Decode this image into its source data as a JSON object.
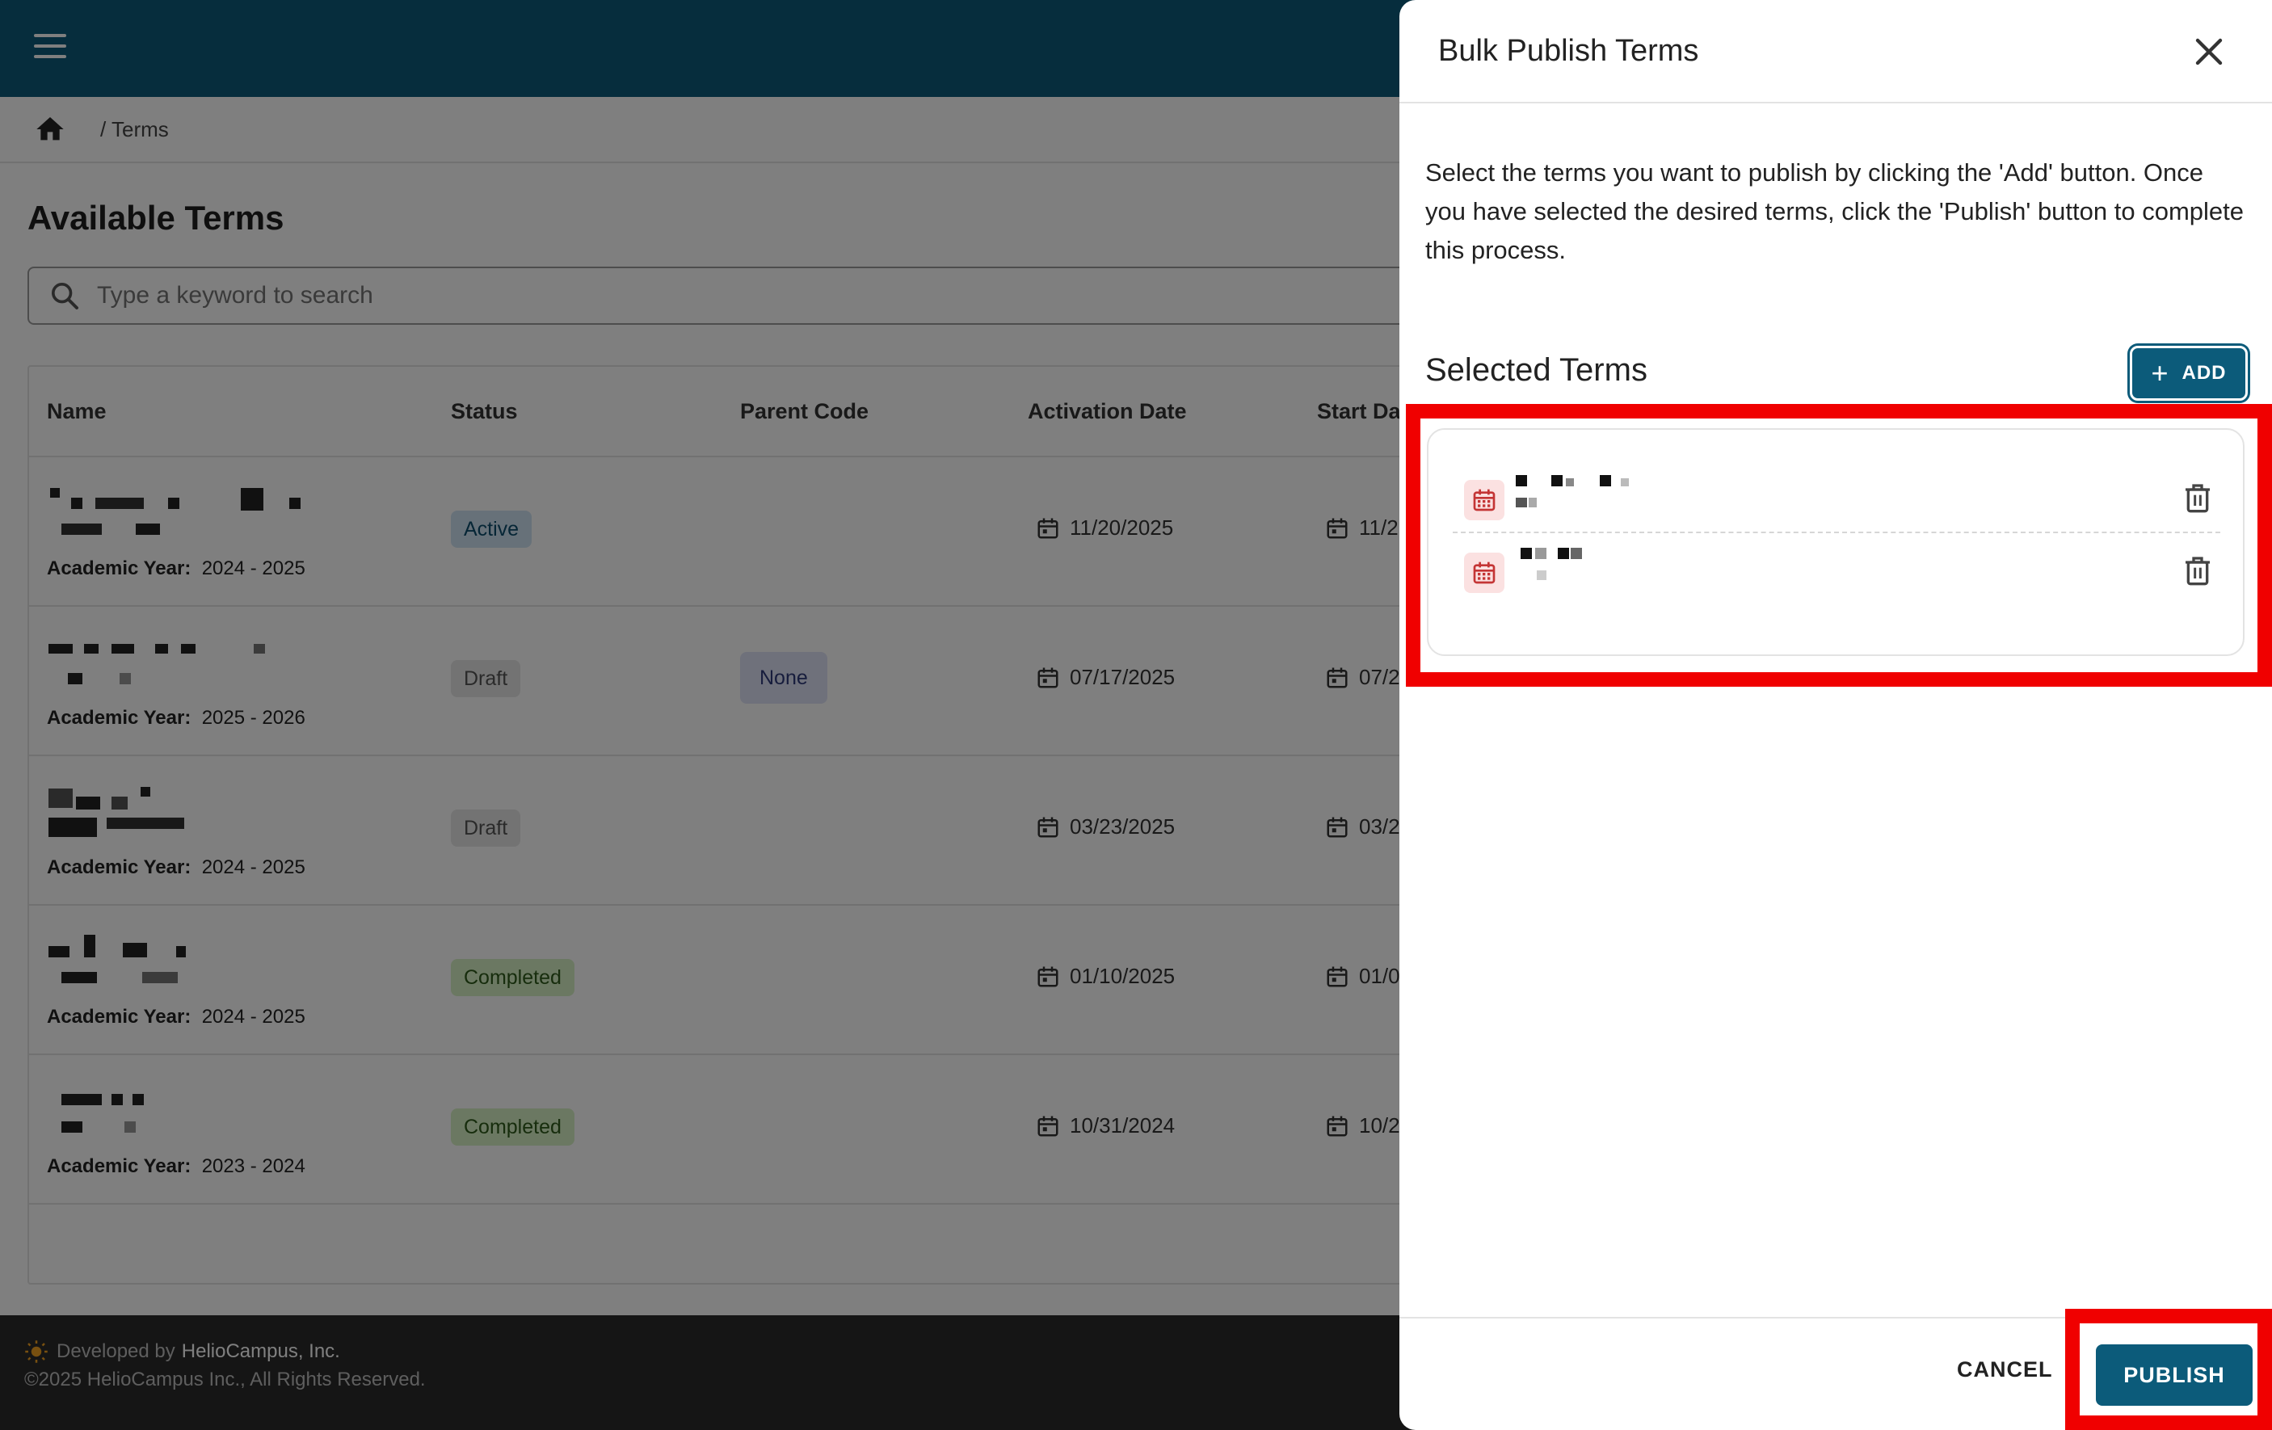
{
  "app": {
    "breadcrumb": "/ Terms",
    "page_title": "Available Terms",
    "search": {
      "placeholder": "Type a keyword to search"
    }
  },
  "table": {
    "columns": [
      "Name",
      "Status",
      "Parent Code",
      "Activation Date",
      "Start Da"
    ],
    "rows": [
      {
        "academic_year_label": "Academic Year:",
        "academic_year": "2024 - 2025",
        "status": "Active",
        "status_kind": "active",
        "parent_code": "",
        "activation_date": "11/20/2025",
        "start_date": "11/2"
      },
      {
        "academic_year_label": "Academic Year:",
        "academic_year": "2025 - 2026",
        "status": "Draft",
        "status_kind": "draft",
        "parent_code": "None",
        "activation_date": "07/17/2025",
        "start_date": "07/2"
      },
      {
        "academic_year_label": "Academic Year:",
        "academic_year": "2024 - 2025",
        "status": "Draft",
        "status_kind": "draft",
        "parent_code": "",
        "activation_date": "03/23/2025",
        "start_date": "03/2"
      },
      {
        "academic_year_label": "Academic Year:",
        "academic_year": "2024 - 2025",
        "status": "Completed",
        "status_kind": "completed",
        "parent_code": "",
        "activation_date": "01/10/2025",
        "start_date": "01/0"
      },
      {
        "academic_year_label": "Academic Year:",
        "academic_year": "2023 - 2024",
        "status": "Completed",
        "status_kind": "completed",
        "parent_code": "",
        "activation_date": "10/31/2024",
        "start_date": "10/2"
      }
    ]
  },
  "footer": {
    "developed_by": "Developed by",
    "company": "HelioCampus, Inc.",
    "copyright": "©2025 HelioCampus Inc., All Rights Reserved."
  },
  "panel": {
    "title": "Bulk Publish Terms",
    "description": "Select the terms you want to publish by clicking the 'Add' button. Once you have selected the desired terms, click the 'Publish' button to complete this process.",
    "selected_title": "Selected Terms",
    "add_label": "ADD",
    "cancel_label": "CANCEL",
    "publish_label": "PUBLISH"
  },
  "colors": {
    "header": "#0c5b7a",
    "primary_button": "#0c5b7a",
    "highlight": "#f00000",
    "footer": "#2a2a2a"
  },
  "icons": [
    "hamburger-icon",
    "home-icon",
    "search-icon",
    "calendar-icon",
    "close-icon",
    "plus-icon",
    "trash-icon",
    "sun-logo-icon"
  ]
}
